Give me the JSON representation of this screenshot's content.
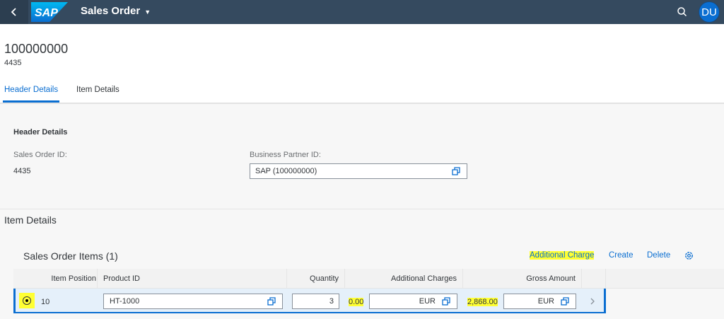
{
  "shell": {
    "logo_text": "SAP",
    "app_title": "Sales Order",
    "avatar_initials": "DU",
    "bg_color": "#354a5f"
  },
  "object_header": {
    "title": "100000000",
    "subtitle": "4435",
    "tabs": [
      {
        "label": "Header Details",
        "active": true
      },
      {
        "label": "Item Details",
        "active": false
      }
    ]
  },
  "header_details": {
    "title": "Header Details",
    "sales_order_id_label": "Sales Order ID:",
    "sales_order_id_value": "4435",
    "business_partner_label": "Business Partner ID:",
    "business_partner_value": "SAP (100000000)"
  },
  "item_details": {
    "section_title": "Item Details",
    "table_title": "Sales Order Items (1)",
    "toolbar": {
      "additional_charge": "Additional Charge",
      "create": "Create",
      "delete": "Delete"
    },
    "columns": [
      "Item Position",
      "Product ID",
      "Quantity",
      "Additional Charges",
      "Gross Amount"
    ],
    "rows": [
      {
        "item_position": "10",
        "product_id": "HT-1000",
        "quantity": "3",
        "additional_charges_value": "0.00",
        "additional_charges_currency": "EUR",
        "gross_amount_value": "2,868.00",
        "gross_amount_currency": "EUR",
        "selected": true
      }
    ]
  },
  "colors": {
    "accent": "#0a6ed1",
    "highlight": "#ffff33"
  },
  "icons": {
    "back": "back-icon",
    "search": "search-icon",
    "copy": "copy-icon",
    "settings": "settings-icon",
    "nav": "chevron-right-icon"
  }
}
